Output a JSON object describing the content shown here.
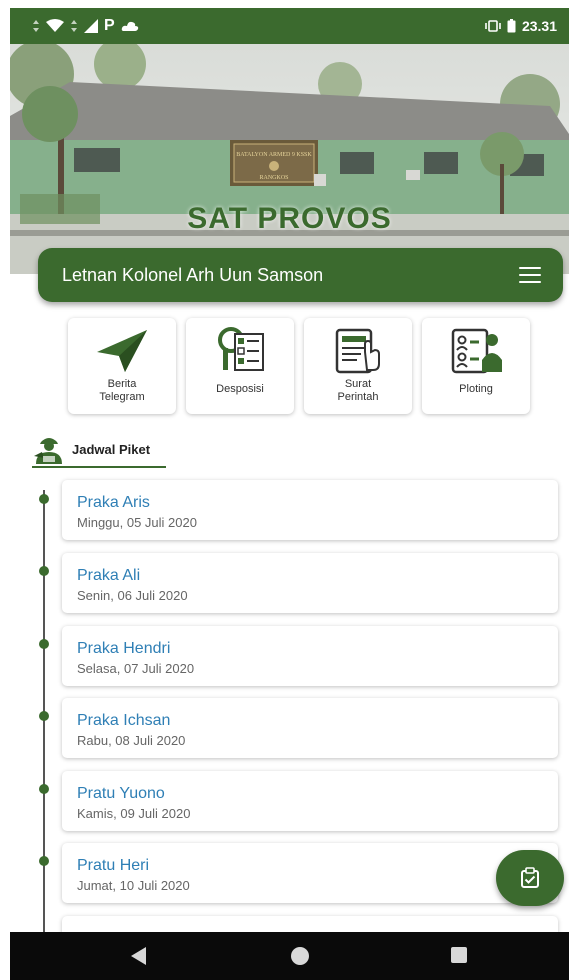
{
  "status_bar": {
    "time": "23.31",
    "icons": [
      "data-arrows-icon",
      "wifi-icon",
      "signal-icon",
      "parking-app-icon",
      "cloud-icon",
      "vibrate-icon",
      "battery-icon"
    ]
  },
  "hero": {
    "title": "SAT PROVOS",
    "sign_line1": "BATALYON ARMED 9 KSSK",
    "sign_line2": "RANGKOS"
  },
  "user_bar": {
    "name": "Letnan Kolonel Arh Uun Samson",
    "menu_icon": "hamburger-menu-icon"
  },
  "tiles": [
    {
      "label_line1": "Berita",
      "label_line2": "Telegram",
      "icon": "paper-plane-icon"
    },
    {
      "label_line1": "Desposisi",
      "label_line2": "",
      "icon": "checklist-search-icon"
    },
    {
      "label_line1": "Surat",
      "label_line2": "Perintah",
      "icon": "tablet-document-icon"
    },
    {
      "label_line1": "Ploting",
      "label_line2": "",
      "icon": "person-assignment-icon"
    }
  ],
  "section": {
    "title": "Jadwal Piket",
    "icon": "soldier-icon"
  },
  "schedule": [
    {
      "name": "Praka Aris",
      "date": "Minggu, 05 Juli 2020"
    },
    {
      "name": "Praka Ali",
      "date": "Senin, 06 Juli 2020"
    },
    {
      "name": "Praka Hendri",
      "date": "Selasa, 07 Juli 2020"
    },
    {
      "name": "Praka Ichsan",
      "date": "Rabu, 08 Juli 2020"
    },
    {
      "name": "Pratu Yuono",
      "date": "Kamis, 09 Juli 2020"
    },
    {
      "name": "Pratu Heri",
      "date": "Jumat, 10 Juli 2020"
    }
  ],
  "fab": {
    "icon": "clipboard-check-icon"
  },
  "nav_bar": {
    "icons": [
      "back-triangle-icon",
      "home-circle-icon",
      "recents-square-icon"
    ]
  },
  "colors": {
    "primary": "#3b6a2e",
    "link": "#2f7fb5",
    "text_muted": "#666666"
  }
}
